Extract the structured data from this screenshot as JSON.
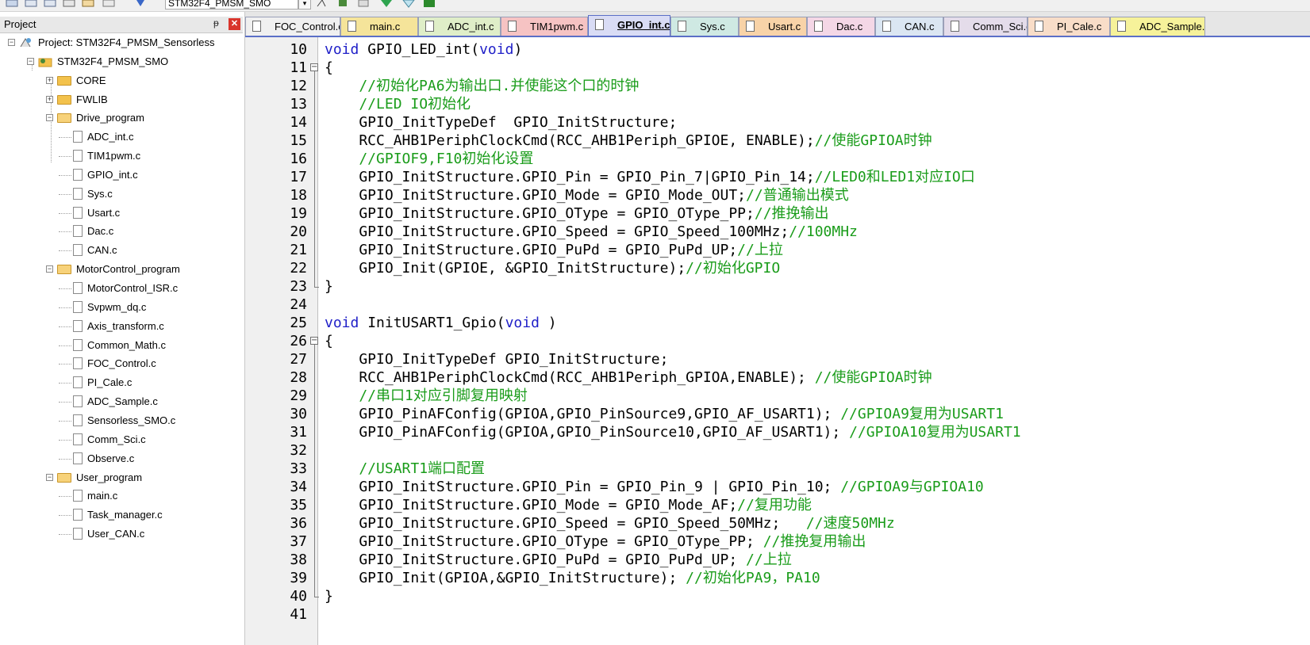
{
  "toolbar": {
    "target_combo": "STM32F4_PMSM_SMO"
  },
  "project_panel": {
    "title": "Project",
    "pin_glyph": "ᵽ",
    "close_glyph": "✕",
    "project_root": "Project: STM32F4_PMSM_Sensorless",
    "target": "STM32F4_PMSM_SMO",
    "groups": [
      {
        "name": "CORE",
        "expanded": false,
        "files": []
      },
      {
        "name": "FWLIB",
        "expanded": false,
        "files": []
      },
      {
        "name": "Drive_program",
        "expanded": true,
        "files": [
          "ADC_int.c",
          "TIM1pwm.c",
          "GPIO_int.c",
          "Sys.c",
          "Usart.c",
          "Dac.c",
          "CAN.c"
        ]
      },
      {
        "name": "MotorControl_program",
        "expanded": true,
        "files": [
          "MotorControl_ISR.c",
          "Svpwm_dq.c",
          "Axis_transform.c",
          "Common_Math.c",
          "FOC_Control.c",
          "PI_Cale.c",
          "ADC_Sample.c",
          "Sensorless_SMO.c",
          "Comm_Sci.c",
          "Observe.c"
        ]
      },
      {
        "name": "User_program",
        "expanded": true,
        "files": [
          "main.c",
          "Task_manager.c",
          "User_CAN.c"
        ]
      }
    ]
  },
  "tabs": [
    {
      "label": "FOC_Control.c",
      "color": "#f0f0f0",
      "active": false
    },
    {
      "label": "main.c",
      "color": "#f5e49a",
      "active": false
    },
    {
      "label": "ADC_int.c",
      "color": "#dfeec8",
      "active": false
    },
    {
      "label": "TIM1pwm.c",
      "color": "#f6c3c3",
      "active": false
    },
    {
      "label": "GPIO_int.c",
      "color": "#d9dcf5",
      "active": true
    },
    {
      "label": "Sys.c",
      "color": "#cfe9e3",
      "active": false
    },
    {
      "label": "Usart.c",
      "color": "#f8d3a8",
      "active": false
    },
    {
      "label": "Dac.c",
      "color": "#f4d7e6",
      "active": false
    },
    {
      "label": "CAN.c",
      "color": "#dbe6f2",
      "active": false
    },
    {
      "label": "Comm_Sci.c",
      "color": "#e4dcea",
      "active": false
    },
    {
      "label": "PI_Cale.c",
      "color": "#f8ddc8",
      "active": false
    },
    {
      "label": "ADC_Sample.c",
      "color": "#f6f29a",
      "active": false
    }
  ],
  "code_lines": [
    {
      "n": "10",
      "fold": "",
      "segs": [
        {
          "t": "void",
          "c": "kw"
        },
        {
          "t": " GPIO_LED_int(",
          "c": ""
        },
        {
          "t": "void",
          "c": "kw"
        },
        {
          "t": ")",
          "c": ""
        }
      ]
    },
    {
      "n": "11",
      "fold": "open",
      "segs": [
        {
          "t": "{",
          "c": ""
        }
      ]
    },
    {
      "n": "12",
      "fold": "",
      "segs": [
        {
          "t": "    //初始化PA6为输出口.并使能这个口的时钟",
          "c": "cm"
        }
      ]
    },
    {
      "n": "13",
      "fold": "",
      "segs": [
        {
          "t": "    //LED IO初始化",
          "c": "cm"
        }
      ]
    },
    {
      "n": "14",
      "fold": "",
      "segs": [
        {
          "t": "    GPIO_InitTypeDef  GPIO_InitStructure;",
          "c": ""
        }
      ]
    },
    {
      "n": "15",
      "fold": "",
      "segs": [
        {
          "t": "    RCC_AHB1PeriphClockCmd(RCC_AHB1Periph_GPIOE, ENABLE);",
          "c": ""
        },
        {
          "t": "//使能GPIOA时钟",
          "c": "cm"
        }
      ]
    },
    {
      "n": "16",
      "fold": "",
      "segs": [
        {
          "t": "    //GPIOF9,F10初始化设置",
          "c": "cm"
        }
      ]
    },
    {
      "n": "17",
      "fold": "",
      "segs": [
        {
          "t": "    GPIO_InitStructure.GPIO_Pin = GPIO_Pin_7|GPIO_Pin_14;",
          "c": ""
        },
        {
          "t": "//LED0和LED1对应IO口",
          "c": "cm"
        }
      ]
    },
    {
      "n": "18",
      "fold": "",
      "segs": [
        {
          "t": "    GPIO_InitStructure.GPIO_Mode = GPIO_Mode_OUT;",
          "c": ""
        },
        {
          "t": "//普通输出模式",
          "c": "cm"
        }
      ]
    },
    {
      "n": "19",
      "fold": "",
      "segs": [
        {
          "t": "    GPIO_InitStructure.GPIO_OType = GPIO_OType_PP;",
          "c": ""
        },
        {
          "t": "//推挽输出",
          "c": "cm"
        }
      ]
    },
    {
      "n": "20",
      "fold": "",
      "segs": [
        {
          "t": "    GPIO_InitStructure.GPIO_Speed = GPIO_Speed_100MHz;",
          "c": ""
        },
        {
          "t": "//100MHz",
          "c": "cm"
        }
      ]
    },
    {
      "n": "21",
      "fold": "",
      "segs": [
        {
          "t": "    GPIO_InitStructure.GPIO_PuPd = GPIO_PuPd_UP;",
          "c": ""
        },
        {
          "t": "//上拉",
          "c": "cm"
        }
      ]
    },
    {
      "n": "22",
      "fold": "",
      "segs": [
        {
          "t": "    GPIO_Init(GPIOE, &GPIO_InitStructure);",
          "c": ""
        },
        {
          "t": "//初始化GPIO",
          "c": "cm"
        }
      ]
    },
    {
      "n": "23",
      "fold": "end",
      "segs": [
        {
          "t": "}",
          "c": ""
        }
      ]
    },
    {
      "n": "24",
      "fold": "",
      "segs": [
        {
          "t": "",
          "c": ""
        }
      ]
    },
    {
      "n": "25",
      "fold": "",
      "segs": [
        {
          "t": "void",
          "c": "kw"
        },
        {
          "t": " InitUSART1_Gpio(",
          "c": ""
        },
        {
          "t": "void",
          "c": "kw"
        },
        {
          "t": " )",
          "c": ""
        }
      ]
    },
    {
      "n": "26",
      "fold": "open",
      "segs": [
        {
          "t": "{",
          "c": ""
        }
      ]
    },
    {
      "n": "27",
      "fold": "",
      "segs": [
        {
          "t": "    GPIO_InitTypeDef GPIO_InitStructure;",
          "c": ""
        }
      ]
    },
    {
      "n": "28",
      "fold": "",
      "segs": [
        {
          "t": "    RCC_AHB1PeriphClockCmd(RCC_AHB1Periph_GPIOA,ENABLE); ",
          "c": ""
        },
        {
          "t": "//使能GPIOA时钟",
          "c": "cm"
        }
      ]
    },
    {
      "n": "29",
      "fold": "",
      "segs": [
        {
          "t": "    //串口1对应引脚复用映射",
          "c": "cm"
        }
      ]
    },
    {
      "n": "30",
      "fold": "",
      "segs": [
        {
          "t": "    GPIO_PinAFConfig(GPIOA,GPIO_PinSource9,GPIO_AF_USART1); ",
          "c": ""
        },
        {
          "t": "//GPIOA9复用为USART1",
          "c": "cm"
        }
      ]
    },
    {
      "n": "31",
      "fold": "",
      "segs": [
        {
          "t": "    GPIO_PinAFConfig(GPIOA,GPIO_PinSource10,GPIO_AF_USART1); ",
          "c": ""
        },
        {
          "t": "//GPIOA10复用为USART1",
          "c": "cm"
        }
      ]
    },
    {
      "n": "32",
      "fold": "",
      "segs": [
        {
          "t": "",
          "c": ""
        }
      ]
    },
    {
      "n": "33",
      "fold": "",
      "segs": [
        {
          "t": "    //USART1端口配置",
          "c": "cm"
        }
      ]
    },
    {
      "n": "34",
      "fold": "",
      "segs": [
        {
          "t": "    GPIO_InitStructure.GPIO_Pin = GPIO_Pin_9 | GPIO_Pin_10; ",
          "c": ""
        },
        {
          "t": "//GPIOA9与GPIOA10",
          "c": "cm"
        }
      ]
    },
    {
      "n": "35",
      "fold": "",
      "segs": [
        {
          "t": "    GPIO_InitStructure.GPIO_Mode = GPIO_Mode_AF;",
          "c": ""
        },
        {
          "t": "//复用功能",
          "c": "cm"
        }
      ]
    },
    {
      "n": "36",
      "fold": "",
      "segs": [
        {
          "t": "    GPIO_InitStructure.GPIO_Speed = GPIO_Speed_50MHz;   ",
          "c": ""
        },
        {
          "t": "//速度50MHz",
          "c": "cm"
        }
      ]
    },
    {
      "n": "37",
      "fold": "",
      "segs": [
        {
          "t": "    GPIO_InitStructure.GPIO_OType = GPIO_OType_PP; ",
          "c": ""
        },
        {
          "t": "//推挽复用输出",
          "c": "cm"
        }
      ]
    },
    {
      "n": "38",
      "fold": "",
      "segs": [
        {
          "t": "    GPIO_InitStructure.GPIO_PuPd = GPIO_PuPd_UP; ",
          "c": ""
        },
        {
          "t": "//上拉",
          "c": "cm"
        }
      ]
    },
    {
      "n": "39",
      "fold": "",
      "segs": [
        {
          "t": "    GPIO_Init(GPIOA,&GPIO_InitStructure); ",
          "c": ""
        },
        {
          "t": "//初始化PA9，PA10",
          "c": "cm"
        }
      ]
    },
    {
      "n": "40",
      "fold": "end",
      "segs": [
        {
          "t": "}",
          "c": ""
        }
      ]
    },
    {
      "n": "41",
      "fold": "",
      "segs": [
        {
          "t": "",
          "c": ""
        }
      ]
    }
  ]
}
